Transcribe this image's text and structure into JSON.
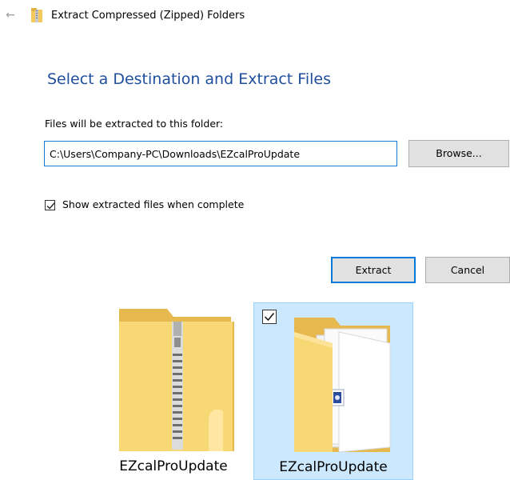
{
  "dialog": {
    "title": "Extract Compressed (Zipped) Folders",
    "back_icon": "back-arrow-icon"
  },
  "main": {
    "heading": "Select a Destination and Extract Files",
    "destination_label": "Files will be extracted to this folder:",
    "destination_value": "C:\\Users\\Company-PC\\Downloads\\EZcalProUpdate",
    "browse_label": "Browse...",
    "show_files_label": "Show extracted files when complete",
    "show_files_checked": true,
    "extract_label": "Extract",
    "cancel_label": "Cancel"
  },
  "files": [
    {
      "name": "EZcalProUpdate",
      "type": "zip-folder",
      "selected": false
    },
    {
      "name": "EZcalProUpdate",
      "type": "folder",
      "selected": true
    }
  ],
  "colors": {
    "heading": "#1e4e9c",
    "accent": "#0078d7",
    "selection": "#cce8ff",
    "folder": "#f8d775"
  }
}
